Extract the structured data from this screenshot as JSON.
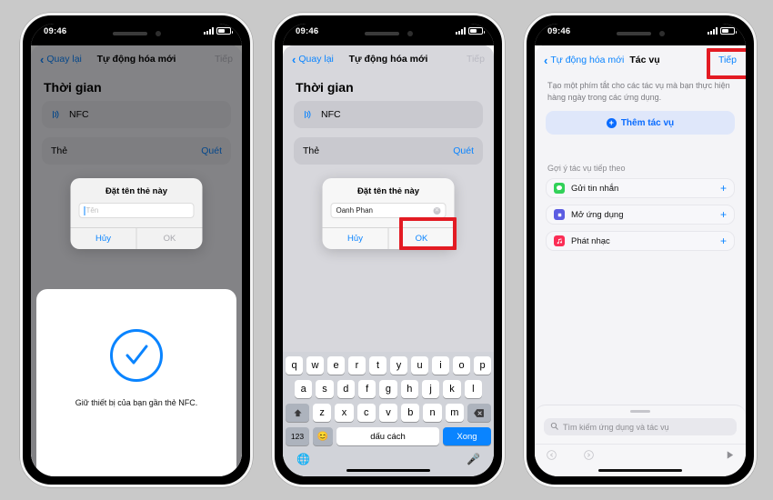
{
  "statusbar": {
    "time": "09:46"
  },
  "phone1": {
    "nav": {
      "back": "Quay lại",
      "title": "Tự động hóa mới",
      "next": "Tiếp"
    },
    "section_title": "Thời gian",
    "nfc_row": {
      "label": "NFC",
      "icon": "nfc-icon"
    },
    "tag_row": {
      "label": "Thẻ",
      "action": "Quét"
    },
    "dialog": {
      "title": "Đặt tên thẻ này",
      "input_placeholder": "Tên",
      "input_value": "",
      "cancel": "Hủy",
      "ok": "OK"
    },
    "nfc_card": {
      "message": "Giữ thiết bị của bạn gần thẻ NFC.",
      "icon": "check-circle-icon",
      "accent": "#0a84ff"
    }
  },
  "phone2": {
    "nav": {
      "back": "Quay lại",
      "title": "Tự động hóa mới",
      "next": "Tiếp"
    },
    "section_title": "Thời gian",
    "nfc_row": {
      "label": "NFC",
      "icon": "nfc-icon"
    },
    "tag_row": {
      "label": "Thẻ",
      "action": "Quét"
    },
    "dialog": {
      "title": "Đặt tên thẻ này",
      "input_value": "Oanh Phan",
      "cancel": "Hủy",
      "ok": "OK",
      "highlight_color": "#e31b23",
      "highlighted_button": "OK"
    },
    "keyboard": {
      "row1": [
        "q",
        "w",
        "e",
        "r",
        "t",
        "y",
        "u",
        "i",
        "o",
        "p"
      ],
      "row2": [
        "a",
        "s",
        "d",
        "f",
        "g",
        "h",
        "j",
        "k",
        "l"
      ],
      "row3": [
        "z",
        "x",
        "c",
        "v",
        "b",
        "n",
        "m"
      ],
      "shift_icon": "shift-icon",
      "backspace_icon": "backspace-icon",
      "numbers_key": "123",
      "emoji_icon": "emoji-icon",
      "space_key": "dấu cách",
      "done_key": "Xong",
      "globe_icon": "globe-icon",
      "mic_icon": "microphone-icon"
    }
  },
  "phone3": {
    "nav": {
      "back": "Tự động hóa mới",
      "title": "Tác vụ",
      "next": "Tiếp",
      "highlight_color": "#e31b23"
    },
    "description": "Tạo một phím tắt cho các tác vụ mà bạn thực hiện hàng ngày trong các ứng dụng.",
    "add_action": {
      "label": "Thêm tác vụ",
      "icon": "plus-circle-icon"
    },
    "suggestions_label": "Gợi ý tác vụ tiếp theo",
    "suggestions": [
      {
        "label": "Gửi tin nhắn",
        "icon": "messages-app-icon",
        "color": "#31d158",
        "add_icon": "plus-icon"
      },
      {
        "label": "Mở ứng dụng",
        "icon": "open-app-icon",
        "color": "#5b5ce2",
        "add_icon": "plus-icon"
      },
      {
        "label": "Phát nhạc",
        "icon": "music-app-icon",
        "color": "#fb2d55",
        "add_icon": "plus-icon"
      }
    ],
    "search": {
      "placeholder": "Tìm kiếm ứng dụng và tác vụ",
      "icon": "search-icon"
    },
    "toolbar": {
      "undo_icon": "undo-icon",
      "redo_icon": "redo-icon",
      "play_icon": "play-icon"
    }
  }
}
